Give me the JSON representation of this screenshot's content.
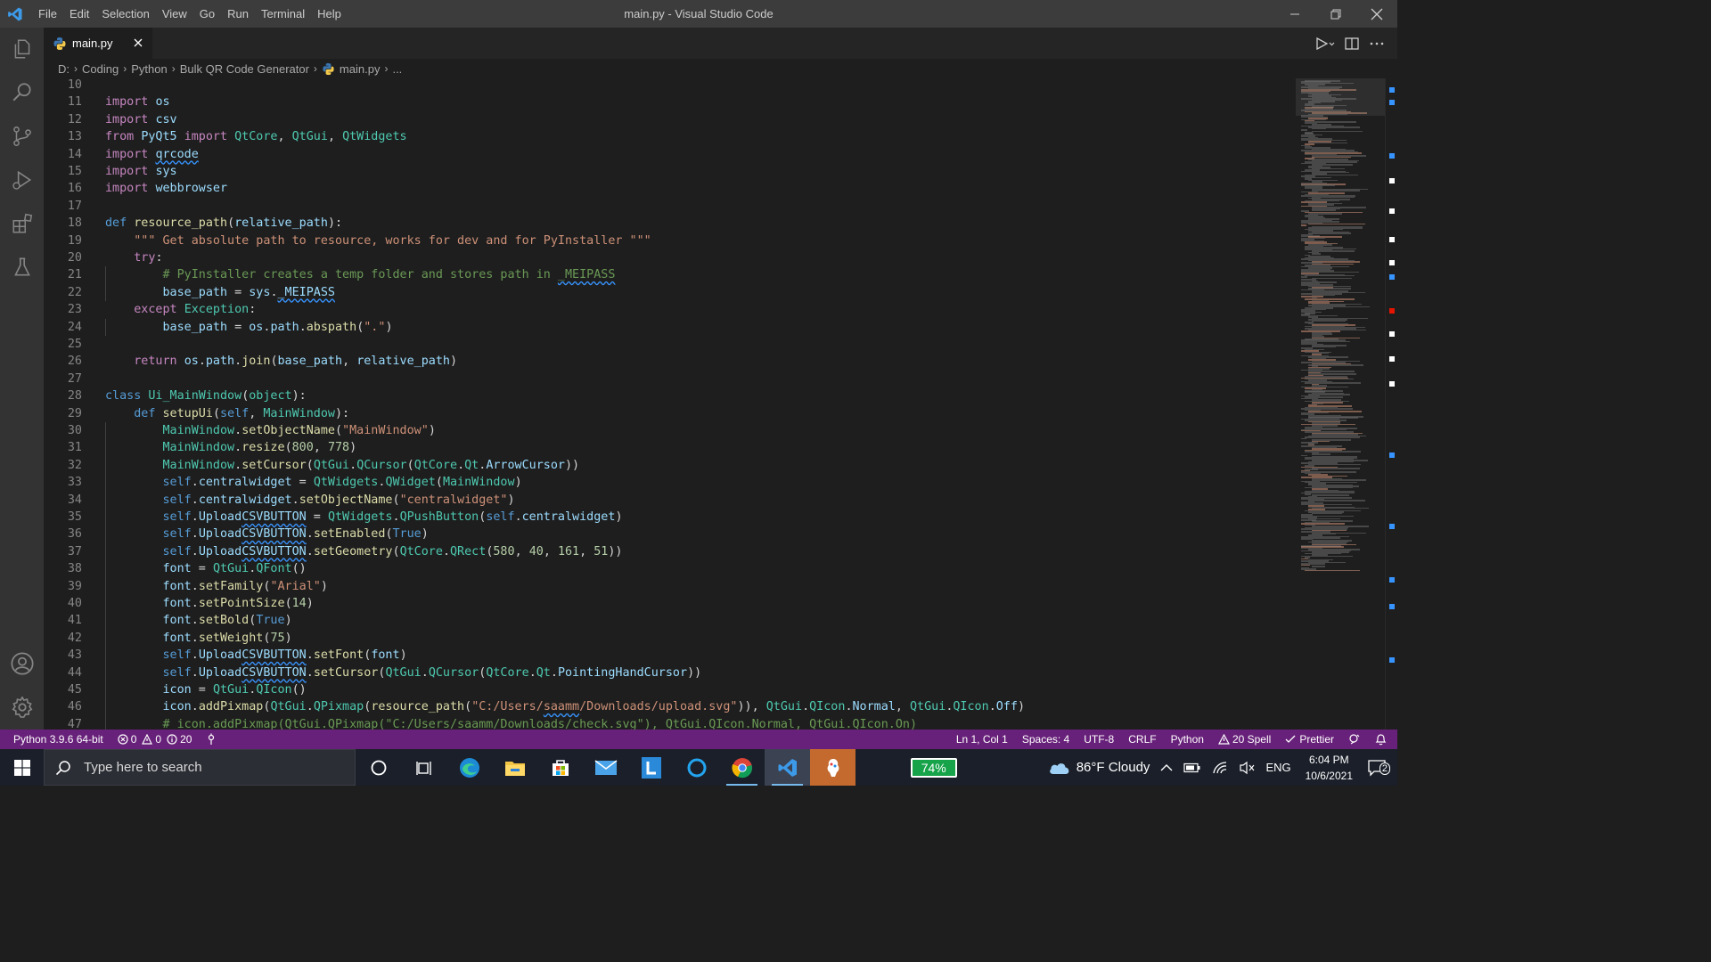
{
  "window": {
    "title": "main.py - Visual Studio Code"
  },
  "menu": [
    "File",
    "Edit",
    "Selection",
    "View",
    "Go",
    "Run",
    "Terminal",
    "Help"
  ],
  "tab": {
    "label": "main.py"
  },
  "breadcrumbs": [
    "D:",
    "Coding",
    "Python",
    "Bulk QR Code Generator",
    "main.py",
    "..."
  ],
  "activity_icons": [
    "explorer-icon",
    "search-icon",
    "source-control-icon",
    "run-debug-icon",
    "extensions-icon",
    "testing-icon",
    "accounts-icon",
    "settings-gear-icon"
  ],
  "code": [
    {
      "n": "10",
      "t": ""
    },
    {
      "n": "11",
      "t": "import os"
    },
    {
      "n": "12",
      "t": "import csv"
    },
    {
      "n": "13",
      "t": "from PyQt5 import QtCore, QtGui, QtWidgets"
    },
    {
      "n": "14",
      "t": "import qrcode"
    },
    {
      "n": "15",
      "t": "import sys"
    },
    {
      "n": "16",
      "t": "import webbrowser"
    },
    {
      "n": "17",
      "t": ""
    },
    {
      "n": "18",
      "t": "def resource_path(relative_path):"
    },
    {
      "n": "19",
      "t": "    \"\"\" Get absolute path to resource, works for dev and for PyInstaller \"\"\""
    },
    {
      "n": "20",
      "t": "    try:"
    },
    {
      "n": "21",
      "t": "        # PyInstaller creates a temp folder and stores path in _MEIPASS"
    },
    {
      "n": "22",
      "t": "        base_path = sys._MEIPASS"
    },
    {
      "n": "23",
      "t": "    except Exception:"
    },
    {
      "n": "24",
      "t": "        base_path = os.path.abspath(\".\")"
    },
    {
      "n": "25",
      "t": ""
    },
    {
      "n": "26",
      "t": "    return os.path.join(base_path, relative_path)"
    },
    {
      "n": "27",
      "t": ""
    },
    {
      "n": "28",
      "t": "class Ui_MainWindow(object):"
    },
    {
      "n": "29",
      "t": "    def setupUi(self, MainWindow):"
    },
    {
      "n": "30",
      "t": "        MainWindow.setObjectName(\"MainWindow\")"
    },
    {
      "n": "31",
      "t": "        MainWindow.resize(800, 778)"
    },
    {
      "n": "32",
      "t": "        MainWindow.setCursor(QtGui.QCursor(QtCore.Qt.ArrowCursor))"
    },
    {
      "n": "33",
      "t": "        self.centralwidget = QtWidgets.QWidget(MainWindow)"
    },
    {
      "n": "34",
      "t": "        self.centralwidget.setObjectName(\"centralwidget\")"
    },
    {
      "n": "35",
      "t": "        self.UploadCSVBUTTON = QtWidgets.QPushButton(self.centralwidget)"
    },
    {
      "n": "36",
      "t": "        self.UploadCSVBUTTON.setEnabled(True)"
    },
    {
      "n": "37",
      "t": "        self.UploadCSVBUTTON.setGeometry(QtCore.QRect(580, 40, 161, 51))"
    },
    {
      "n": "38",
      "t": "        font = QtGui.QFont()"
    },
    {
      "n": "39",
      "t": "        font.setFamily(\"Arial\")"
    },
    {
      "n": "40",
      "t": "        font.setPointSize(14)"
    },
    {
      "n": "41",
      "t": "        font.setBold(True)"
    },
    {
      "n": "42",
      "t": "        font.setWeight(75)"
    },
    {
      "n": "43",
      "t": "        self.UploadCSVBUTTON.setFont(font)"
    },
    {
      "n": "44",
      "t": "        self.UploadCSVBUTTON.setCursor(QtGui.QCursor(QtCore.Qt.PointingHandCursor))"
    },
    {
      "n": "45",
      "t": "        icon = QtGui.QIcon()"
    },
    {
      "n": "46",
      "t": "        icon.addPixmap(QtGui.QPixmap(resource_path(\"C:/Users/saamm/Downloads/upload.svg\")), QtGui.QIcon.Normal, QtGui.QIcon.Off)"
    },
    {
      "n": "47",
      "t": "        # icon.addPixmap(QtGui.QPixmap(\"C:/Users/saamm/Downloads/check.svg\"), QtGui.QIcon.Normal, QtGui.QIcon.On)"
    }
  ],
  "status": {
    "interpreter": "Python 3.9.6 64-bit",
    "errors": "0",
    "warnings": "0",
    "infos": "20",
    "position": "Ln 1, Col 1",
    "spaces": "Spaces: 4",
    "encoding": "UTF-8",
    "eol": "CRLF",
    "language": "Python",
    "spell": "20 Spell",
    "prettier": "Prettier"
  },
  "taskbar": {
    "search_placeholder": "Type here to search",
    "apps": [
      "cortana-icon",
      "task-view-icon",
      "edge-icon",
      "file-explorer-icon",
      "store-icon",
      "mail-icon",
      "app-l-icon",
      "cortana-circle-icon",
      "chrome-icon",
      "vscode-icon",
      "paint-icon"
    ],
    "battery": "74%",
    "weather": "86°F  Cloudy",
    "language": "ENG",
    "time": "6:04 PM",
    "date": "10/6/2021",
    "notifications": "2"
  },
  "colors": {
    "statusbar": "#68217a",
    "accent": "#007acc"
  }
}
